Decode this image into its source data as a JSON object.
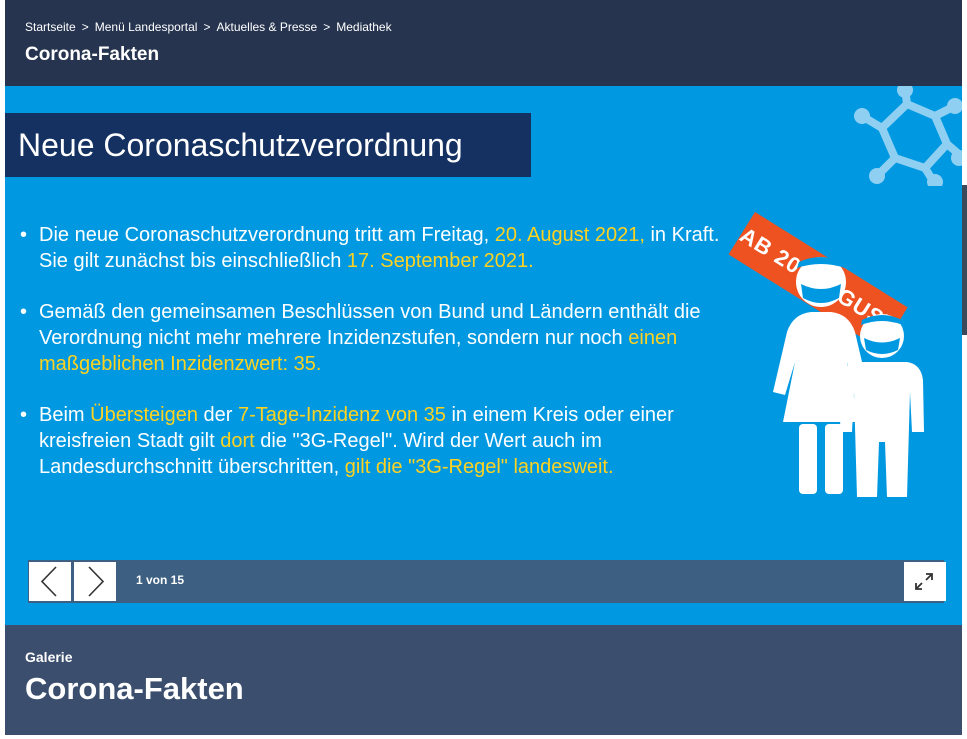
{
  "breadcrumb": [
    {
      "label": "Startseite"
    },
    {
      "label": "Menü Landesportal"
    },
    {
      "label": "Aktuelles & Presse"
    },
    {
      "label": "Mediathek"
    }
  ],
  "breadcrumb_separator": ">",
  "page_title": "Corona-Fakten",
  "slide": {
    "title": "Neue Coronaschutzverordnung",
    "badge": "AB 20. AUGUST",
    "bullet_symbol": "•",
    "bullets": [
      {
        "parts": [
          {
            "text": "Die neue Coronaschutzverordnung tritt am Freitag, "
          },
          {
            "text": "20. August 2021,",
            "hl": true
          },
          {
            "text": " in Kraft. Sie gilt zunächst bis einschließlich "
          },
          {
            "text": "17. September 2021.",
            "hl": true
          }
        ]
      },
      {
        "parts": [
          {
            "text": "Gemäß den gemeinsamen Beschlüssen von Bund und Ländern enthält die Verordnung nicht mehr mehrere Inzidenzstufen, sondern nur noch "
          },
          {
            "text": "einen maßgeblichen Inzidenzwert: 35.",
            "hl": true
          }
        ]
      },
      {
        "parts": [
          {
            "text": "Beim "
          },
          {
            "text": "Übersteigen",
            "hl": true
          },
          {
            "text": " der "
          },
          {
            "text": "7-Tage-Inzidenz von 35",
            "hl": true
          },
          {
            "text": " in einem Kreis oder einer kreisfreien Stadt gilt "
          },
          {
            "text": "dort",
            "hl": true
          },
          {
            "text": " die \"3G-Regel\". Wird der Wert auch im Landesdurchschnitt überschritten, "
          },
          {
            "text": "gilt die \"3G-Regel\" landesweit.",
            "hl": true
          }
        ]
      }
    ]
  },
  "gallery": {
    "counter": "1 von 15",
    "prev_icon": "chevron-left-icon",
    "next_icon": "chevron-right-icon",
    "fullscreen_icon": "expand-icon"
  },
  "footer": {
    "label": "Galerie",
    "title": "Corona-Fakten"
  },
  "colors": {
    "header_bg": "#26344f",
    "slide_bg": "#0099e1",
    "title_bar": "#143162",
    "highlight": "#ffd21f",
    "badge": "#ee5220",
    "controls_bg": "#3d5f82",
    "footer_bg": "#3b4e6d"
  }
}
